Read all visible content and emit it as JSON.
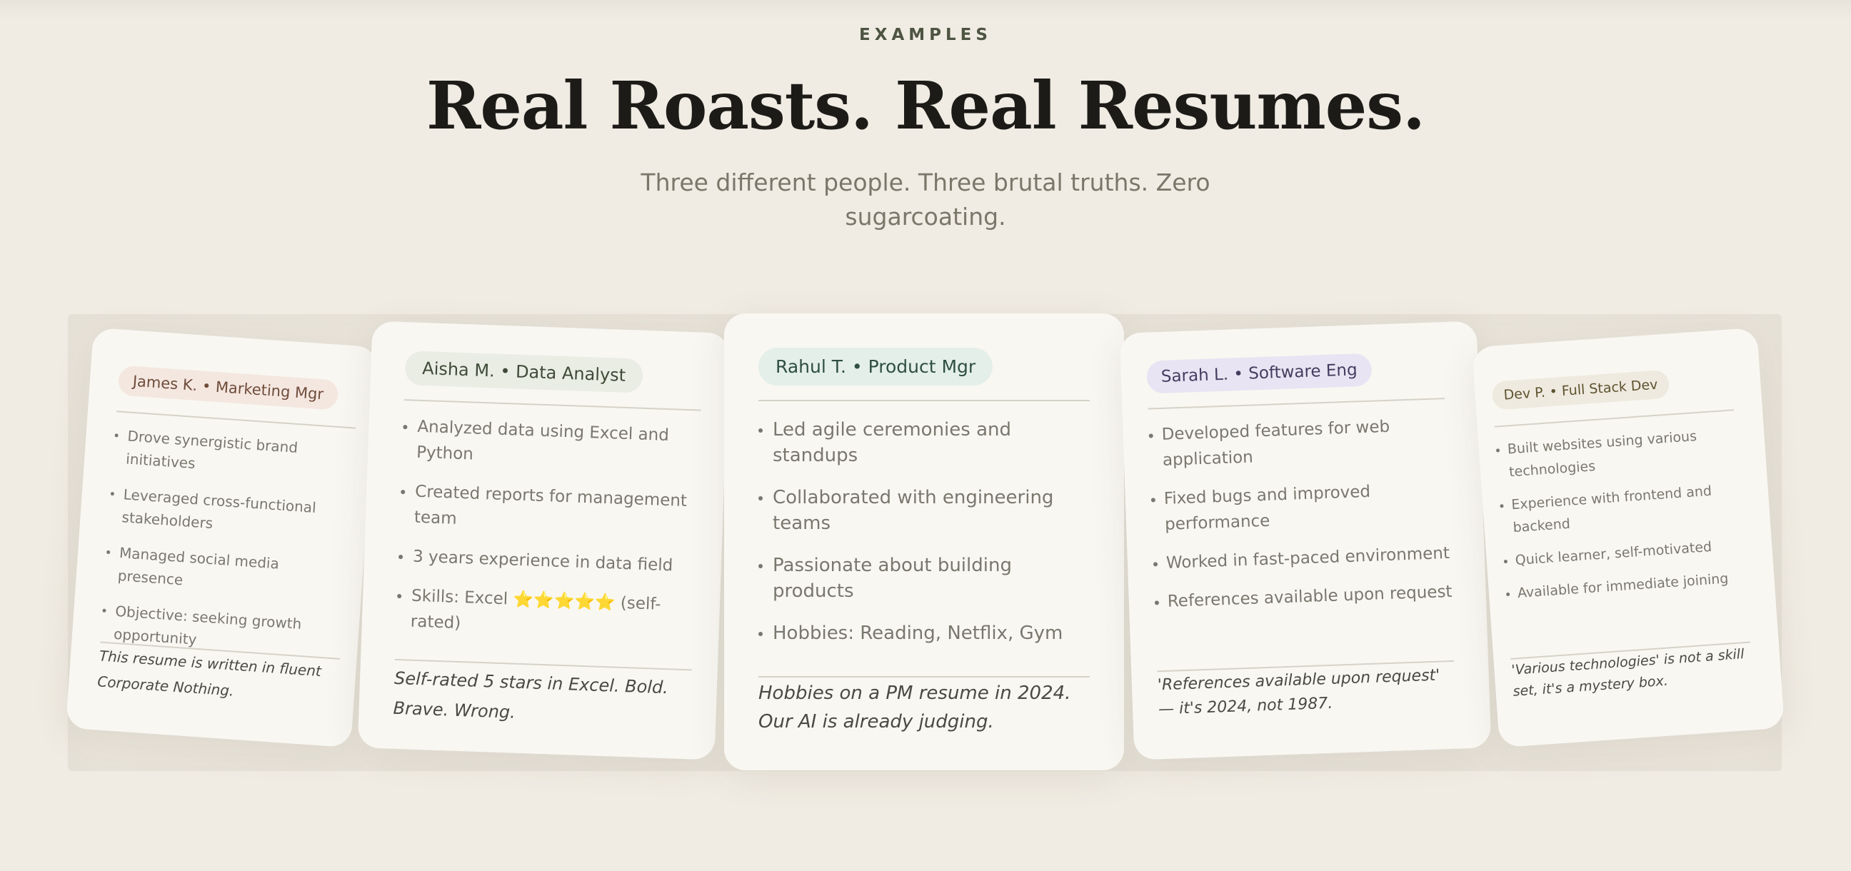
{
  "header": {
    "eyebrow": "EXAMPLES",
    "headline": "Real Roasts. Real Resumes.",
    "subtitle": "Three different people. Three brutal truths. Zero sugarcoating."
  },
  "cards": [
    {
      "tag": "James K. • Marketing Mgr",
      "bullets": [
        "Drove synergistic brand initiatives",
        "Leveraged cross-functional stakeholders",
        "Managed social media presence",
        "Objective: seeking growth opportunity"
      ],
      "verdict": "This resume is written in fluent Corporate Nothing."
    },
    {
      "tag": "Aisha M. • Data Analyst",
      "bullets": [
        "Analyzed data using Excel and Python",
        "Created reports for management team",
        "3 years experience in data field",
        "Skills: Excel ⭐⭐⭐⭐⭐ (self-rated)"
      ],
      "verdict": "Self-rated 5 stars in Excel. Bold. Brave. Wrong."
    },
    {
      "tag": "Rahul T. • Product Mgr",
      "bullets": [
        "Led agile ceremonies and standups",
        "Collaborated with engineering teams",
        "Passionate about building products",
        "Hobbies: Reading, Netflix, Gym"
      ],
      "verdict": "Hobbies on a PM resume in 2024. Our AI is already judging."
    },
    {
      "tag": "Sarah L. • Software Eng",
      "bullets": [
        "Developed features for web application",
        "Fixed bugs and improved performance",
        "Worked in fast-paced environment",
        "References available upon request"
      ],
      "verdict": "'References available upon request' — it's 2024, not 1987."
    },
    {
      "tag": "Dev P. • Full Stack Dev",
      "bullets": [
        "Built websites using various technologies",
        "Experience with frontend and backend",
        "Quick learner, self-motivated",
        "Available for immediate joining"
      ],
      "verdict": "'Various technologies' is not a skill set, it's a mystery box."
    }
  ]
}
